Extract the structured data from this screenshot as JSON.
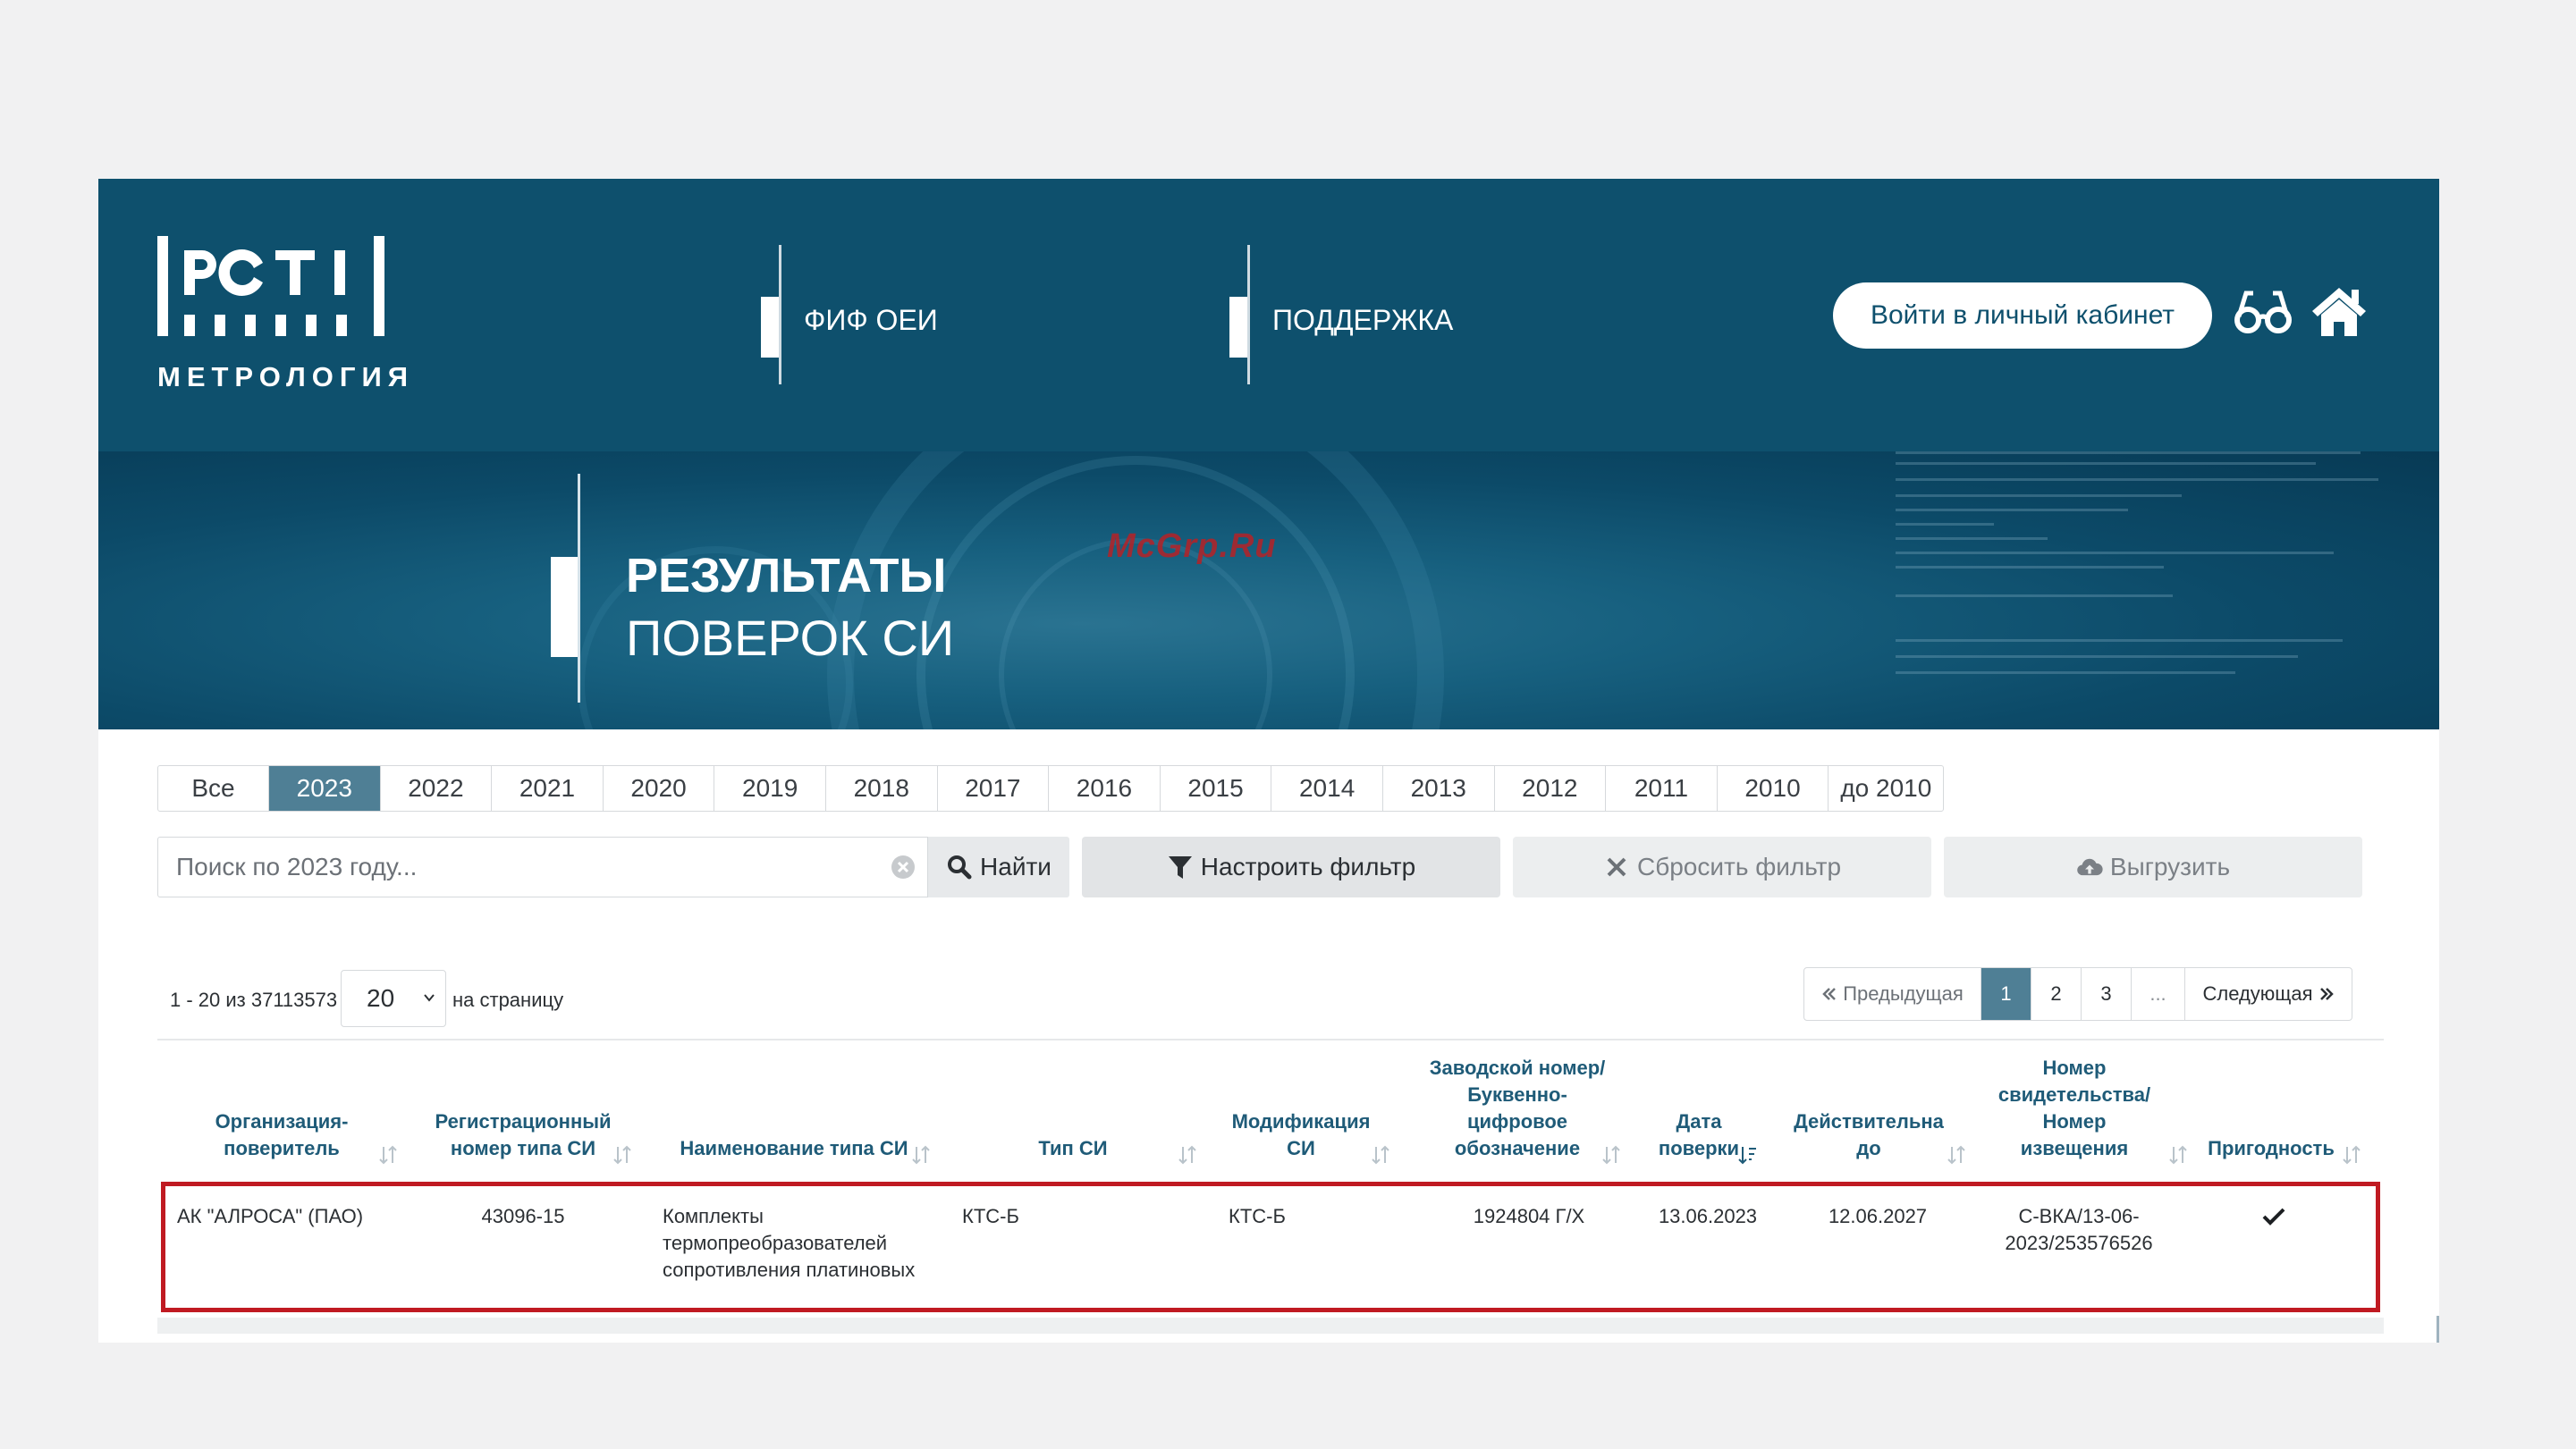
{
  "header": {
    "logo_text": "МЕТРОЛОГИЯ",
    "nav": [
      {
        "label": "ФИФ ОЕИ"
      },
      {
        "label": "ПОДДЕРЖКА"
      }
    ],
    "login_label": "Войти в личный кабинет"
  },
  "banner": {
    "title": "РЕЗУЛЬТАТЫ",
    "subtitle": "ПОВЕРОК СИ"
  },
  "watermark": "McGrp.Ru",
  "years": [
    "Все",
    "2023",
    "2022",
    "2021",
    "2020",
    "2019",
    "2018",
    "2017",
    "2016",
    "2015",
    "2014",
    "2013",
    "2012",
    "2011",
    "2010",
    "до 2010"
  ],
  "active_year": "2023",
  "search": {
    "placeholder": "Поиск по 2023 году...",
    "find_label": "Найти",
    "filter_label": "Настроить фильтр",
    "reset_label": "Сбросить фильтр",
    "export_label": "Выгрузить"
  },
  "pagination": {
    "range_text": "1 - 20 из 37113573",
    "per_page_value": "20",
    "per_page_label": "на страницу",
    "prev_label": "Предыдущая",
    "pages": [
      "1",
      "2",
      "3"
    ],
    "current_page": "1",
    "ellipsis": "...",
    "next_label": "Следующая"
  },
  "table": {
    "columns": [
      "Организация-\nповеритель",
      "Регистрационный\nномер типа СИ",
      "Наименование типа СИ",
      "Тип СИ",
      "Модификация\nСИ",
      "Заводской номер/\nБуквенно-\nцифровое\nобозначение",
      "Дата\nповерки",
      "Действительна\nдо",
      "Номер\nсвидетельства/\nНомер\nизвещения",
      "Пригодность"
    ],
    "rows": [
      {
        "org": "АК \"АЛРОСА\" (ПАО)",
        "reg_number": "43096-15",
        "type_name": "Комплекты\nтермопреобразователей\nсопротивления платиновых",
        "si_type": "КТС-Б",
        "modification": "КТС-Б",
        "serial": "1924804 Г/Х",
        "verify_date": "13.06.2023",
        "valid_until": "12.06.2027",
        "cert_number": "С-ВКА/13-06-\n2023/253576526",
        "suitable": "check-icon"
      }
    ]
  },
  "colors": {
    "header_bg": "#0e506d",
    "accent": "#4f7f95",
    "highlight_border": "#c01a22",
    "header_text": "#1f5b78"
  }
}
